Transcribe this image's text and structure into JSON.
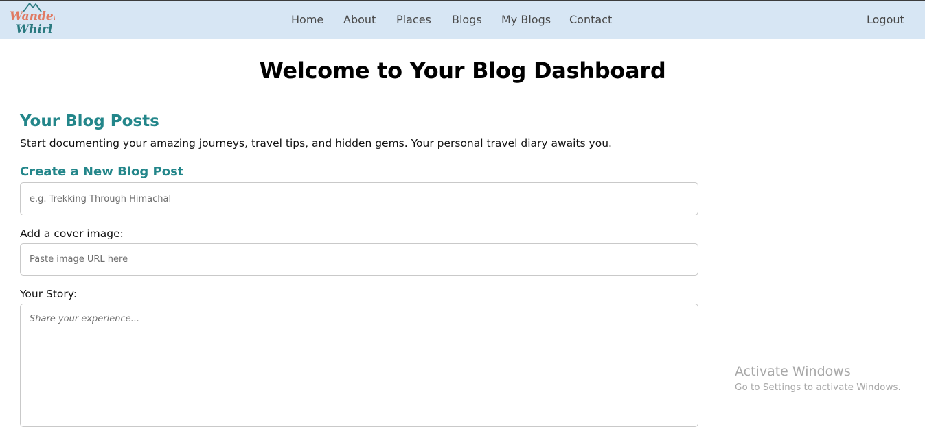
{
  "brand": {
    "logo_line1": "Wander",
    "logo_line2": "Whirl",
    "colors": {
      "line1": "#e07a62",
      "line2": "#2a7a80",
      "mountain": "#2a7a80"
    }
  },
  "nav": {
    "items": [
      {
        "label": "Home"
      },
      {
        "label": "About"
      },
      {
        "label": "Places"
      },
      {
        "label": "Blogs"
      },
      {
        "label": "My Blogs"
      },
      {
        "label": "Contact"
      }
    ],
    "logout_label": "Logout",
    "bg_color": "#d7e6f4"
  },
  "main": {
    "title": "Welcome to Your Blog Dashboard",
    "section_title": "Your Blog Posts",
    "section_desc": "Start documenting your amazing journeys, travel tips, and hidden gems. Your personal travel diary awaits you.",
    "create_title": "Create a New Blog Post",
    "accent_color": "#23868a"
  },
  "form": {
    "title_placeholder": "e.g. Trekking Through Himachal",
    "title_value": "",
    "cover_label": "Add a cover image:",
    "cover_placeholder": "Paste image URL here",
    "cover_value": "",
    "story_label": "Your Story:",
    "story_placeholder": "Share your experience...",
    "story_value": ""
  },
  "watermark": {
    "title": "Activate Windows",
    "subtitle": "Go to Settings to activate Windows."
  }
}
